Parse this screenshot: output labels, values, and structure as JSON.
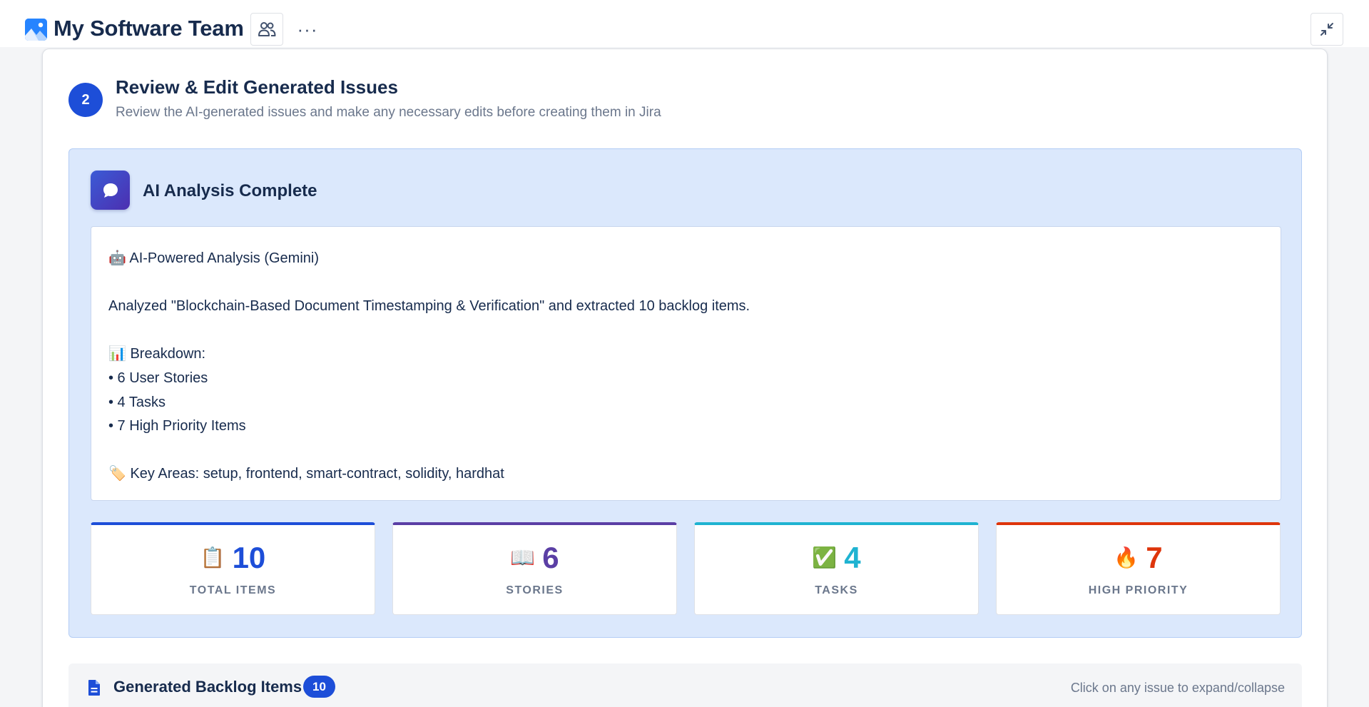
{
  "header": {
    "title": "My Software Team",
    "logo_icon": "image-icon",
    "team_icon": "people-icon",
    "more_label": "···",
    "collapse_icon": "collapse-arrows-icon"
  },
  "step": {
    "number": "2",
    "title": "Review & Edit Generated Issues",
    "subtitle": "Review the AI-generated issues and make any necessary edits before creating them in Jira"
  },
  "ai_panel": {
    "title": "AI Analysis Complete",
    "icon": "chat-bubble-icon",
    "lines": [
      "🤖 AI-Powered Analysis (Gemini)",
      "",
      "Analyzed \"Blockchain-Based Document Timestamping & Verification\" and extracted 10 backlog items.",
      "",
      "📊 Breakdown:",
      "• 6 User Stories",
      "• 4 Tasks",
      "• 7 High Priority Items",
      "",
      "🏷️ Key Areas: setup, frontend, smart-contract, solidity, hardhat"
    ]
  },
  "stats": [
    {
      "emoji": "📋",
      "value": "10",
      "label": "TOTAL ITEMS",
      "color": "#1d4ed8"
    },
    {
      "emoji": "📖",
      "value": "6",
      "label": "STORIES",
      "color": "#5b3fa5"
    },
    {
      "emoji": "✅",
      "value": "4",
      "label": "TASKS",
      "color": "#1fb3d1"
    },
    {
      "emoji": "🔥",
      "value": "7",
      "label": "HIGH PRIORITY",
      "color": "#de350b"
    }
  ],
  "backlog": {
    "title": "Generated Backlog Items",
    "count": "10",
    "hint": "Click on any issue to expand/collapse",
    "icon": "document-icon"
  }
}
